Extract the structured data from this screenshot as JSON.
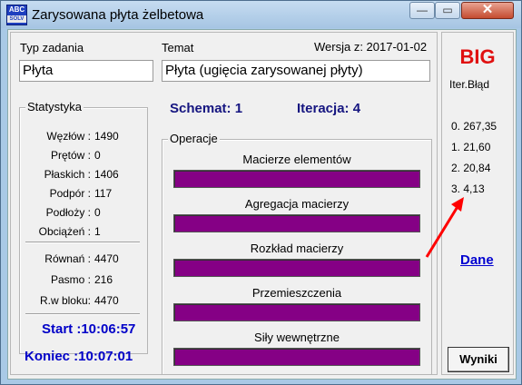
{
  "window": {
    "title": "Zarysowana płyta żelbetowa",
    "app_icon_text_top": "ABC",
    "app_icon_text_bottom": "SOLV"
  },
  "titlebar_buttons": {
    "minimize": "—",
    "maximize": "▭",
    "close": "✕"
  },
  "header": {
    "task_type_label": "Typ zadania",
    "task_type_value": "Płyta",
    "topic_label": "Temat",
    "topic_value": "Płyta (ugięcia zarysowanej płyty)",
    "version": "Wersja z: 2017-01-02"
  },
  "stats": {
    "title": "Statystyka",
    "rows1": [
      {
        "key": "Węzłów :",
        "value": "1490"
      },
      {
        "key": "Prętów :",
        "value": "0"
      },
      {
        "key": "Płaskich :",
        "value": "1406"
      },
      {
        "key": "Podpór :",
        "value": "117"
      },
      {
        "key": "Podłoży :",
        "value": "0"
      },
      {
        "key": "Obciążeń :",
        "value": "1"
      }
    ],
    "rows2": [
      {
        "key": "Równań :",
        "value": "4470"
      },
      {
        "key": "Pasmo :",
        "value": "216"
      },
      {
        "key": "R.w bloku:",
        "value": "4470"
      }
    ],
    "start": "Start :10:06:57",
    "end": "Koniec :10:07:01"
  },
  "schema": {
    "schemat": "Schemat: 1",
    "iteracja": "Iteracja: 4"
  },
  "operations": {
    "title": "Operacje",
    "items": [
      {
        "label": "Macierze elementów",
        "progress": 1.0
      },
      {
        "label": "Agregacja macierzy",
        "progress": 1.0
      },
      {
        "label": "Rozkład macierzy",
        "progress": 1.0
      },
      {
        "label": "Przemieszczenia",
        "progress": 1.0
      },
      {
        "label": "Siły wewnętrzne",
        "progress": 1.0
      }
    ],
    "bar_color": "#850085"
  },
  "side": {
    "big": "BIG",
    "iter_header": "Iter.Błąd",
    "iterations": [
      "0. 267,35",
      "1. 21,60",
      "2. 20,84",
      "3. 4,13"
    ],
    "dane_link": "Dane",
    "wyniki_button": "Wyniki"
  },
  "colors": {
    "accent_red": "#e01010",
    "link_blue": "#0000d0",
    "time_blue": "#0000c8",
    "navy": "#151580"
  }
}
